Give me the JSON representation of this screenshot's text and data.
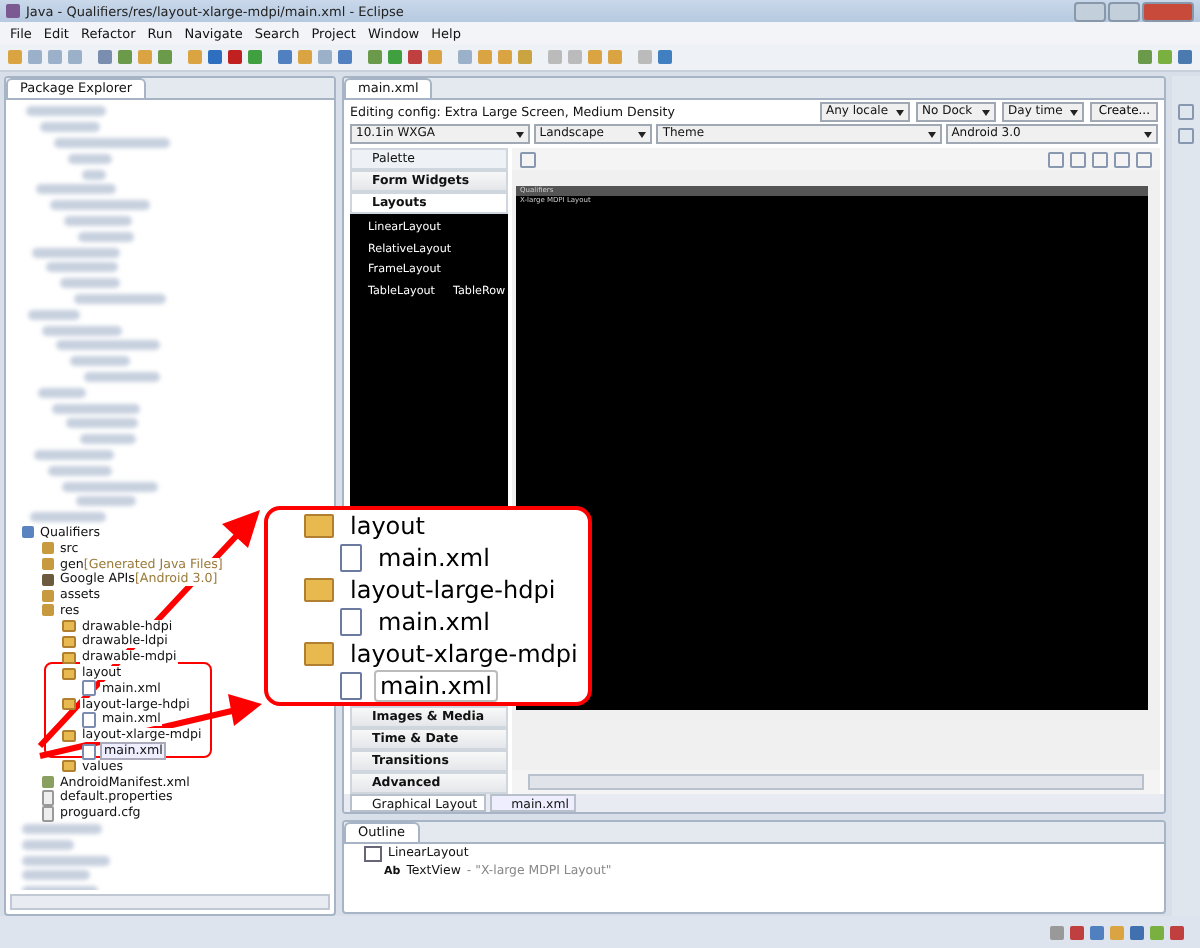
{
  "window": {
    "title": "Java - Qualifiers/res/layout-xlarge-mdpi/main.xml - Eclipse"
  },
  "menu": [
    "File",
    "Edit",
    "Refactor",
    "Run",
    "Navigate",
    "Search",
    "Project",
    "Window",
    "Help"
  ],
  "package_explorer": {
    "title": "Package Explorer",
    "tree": [
      {
        "label": "Qualifiers",
        "kind": "project",
        "selected": false,
        "children": [
          {
            "label": "src",
            "kind": "package",
            "selected": false
          },
          {
            "label": "gen",
            "suffix": "[Generated Java Files]",
            "kind": "package",
            "selected": false
          },
          {
            "label": "Google APIs",
            "suffix": "[Android 3.0]",
            "kind": "library",
            "selected": false
          },
          {
            "label": "assets",
            "kind": "package",
            "selected": false
          },
          {
            "label": "res",
            "kind": "package",
            "selected": false,
            "children": [
              {
                "label": "drawable-hdpi",
                "kind": "folder",
                "selected": false
              },
              {
                "label": "drawable-ldpi",
                "kind": "folder",
                "selected": false
              },
              {
                "label": "drawable-mdpi",
                "kind": "folder",
                "selected": false
              },
              {
                "label": "layout",
                "kind": "folder",
                "selected": false,
                "children": [
                  {
                    "label": "main.xml",
                    "kind": "xml",
                    "selected": false
                  }
                ]
              },
              {
                "label": "layout-large-hdpi",
                "kind": "folder",
                "selected": false,
                "children": [
                  {
                    "label": "main.xml",
                    "kind": "xml",
                    "selected": false
                  }
                ]
              },
              {
                "label": "layout-xlarge-mdpi",
                "kind": "folder",
                "selected": false,
                "children": [
                  {
                    "label": "main.xml",
                    "kind": "xml",
                    "selected": true
                  }
                ]
              },
              {
                "label": "values",
                "kind": "folder",
                "selected": false
              }
            ]
          },
          {
            "label": "AndroidManifest.xml",
            "kind": "manifest",
            "selected": false
          },
          {
            "label": "default.properties",
            "kind": "file",
            "selected": false
          },
          {
            "label": "proguard.cfg",
            "kind": "file",
            "selected": false
          }
        ]
      }
    ]
  },
  "editor": {
    "tab": "main.xml",
    "config_label": "Editing config: Extra Large Screen, Medium Density",
    "top_dropdowns": [
      "Any locale",
      "No Dock",
      "Day time"
    ],
    "create_button": "Create...",
    "dropdowns": [
      "10.1in WXGA",
      "Landscape",
      "Theme",
      "Android 3.0"
    ],
    "palette": {
      "title": "Palette",
      "categories": [
        {
          "label": "Form Widgets",
          "expanded": false
        },
        {
          "label": "Layouts",
          "expanded": true,
          "items": [
            [
              "LinearLayout"
            ],
            [
              "RelativeLayout"
            ],
            [
              "FrameLayout"
            ],
            [
              "TableLayout",
              "TableRow"
            ]
          ]
        },
        {
          "label": "Images & Media",
          "expanded": false
        },
        {
          "label": "Time & Date",
          "expanded": false
        },
        {
          "label": "Transitions",
          "expanded": false
        },
        {
          "label": "Advanced",
          "expanded": false
        }
      ]
    },
    "device": {
      "title": "Qualifiers",
      "text": "X-large MDPI Layout"
    },
    "bottom_tabs": [
      {
        "label": "Graphical Layout",
        "selected": true
      },
      {
        "label": "main.xml",
        "selected": false
      }
    ]
  },
  "outline": {
    "title": "Outline",
    "root": "LinearLayout",
    "child": {
      "icon_text": "Ab",
      "label": "TextView",
      "detail": "- \"X-large MDPI Layout\""
    }
  },
  "callout": [
    {
      "label": "layout",
      "kind": "folder",
      "selected": false
    },
    {
      "label": "main.xml",
      "kind": "xml",
      "selected": false
    },
    {
      "label": "layout-large-hdpi",
      "kind": "folder",
      "selected": false
    },
    {
      "label": "main.xml",
      "kind": "xml",
      "selected": false
    },
    {
      "label": "layout-xlarge-mdpi",
      "kind": "folder",
      "selected": false
    },
    {
      "label": "main.xml",
      "kind": "xml",
      "selected": true
    }
  ]
}
